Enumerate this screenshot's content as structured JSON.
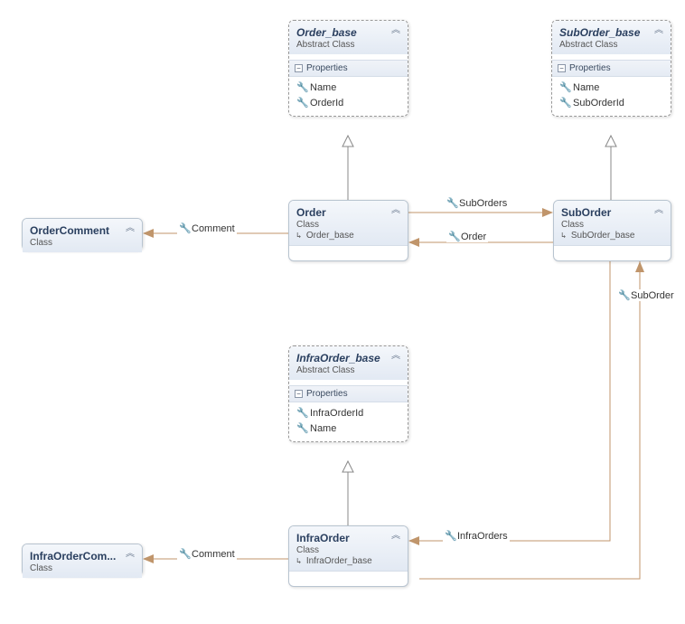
{
  "classes": {
    "orderBase": {
      "name": "Order_base",
      "stereotype": "Abstract Class",
      "propsHeader": "Properties",
      "props": [
        "Name",
        "OrderId"
      ]
    },
    "subOrderBase": {
      "name": "SubOrder_base",
      "stereotype": "Abstract Class",
      "propsHeader": "Properties",
      "props": [
        "Name",
        "SubOrderId"
      ]
    },
    "order": {
      "name": "Order",
      "stereotype": "Class",
      "base": "Order_base"
    },
    "subOrder": {
      "name": "SubOrder",
      "stereotype": "Class",
      "base": "SubOrder_base"
    },
    "orderComment": {
      "name": "OrderComment",
      "stereotype": "Class"
    },
    "infraOrderBase": {
      "name": "InfraOrder_base",
      "stereotype": "Abstract Class",
      "propsHeader": "Properties",
      "props": [
        "InfraOrderId",
        "Name"
      ]
    },
    "infraOrder": {
      "name": "InfraOrder",
      "stereotype": "Class",
      "base": "InfraOrder_base"
    },
    "infraOrderComment": {
      "name": "InfraOrderCom...",
      "stereotype": "Class"
    }
  },
  "labels": {
    "comment1": "Comment",
    "subOrders": "SubOrders",
    "orderBack": "Order",
    "subOrderBack": "SubOrder",
    "infraOrders": "InfraOrders",
    "comment2": "Comment"
  }
}
